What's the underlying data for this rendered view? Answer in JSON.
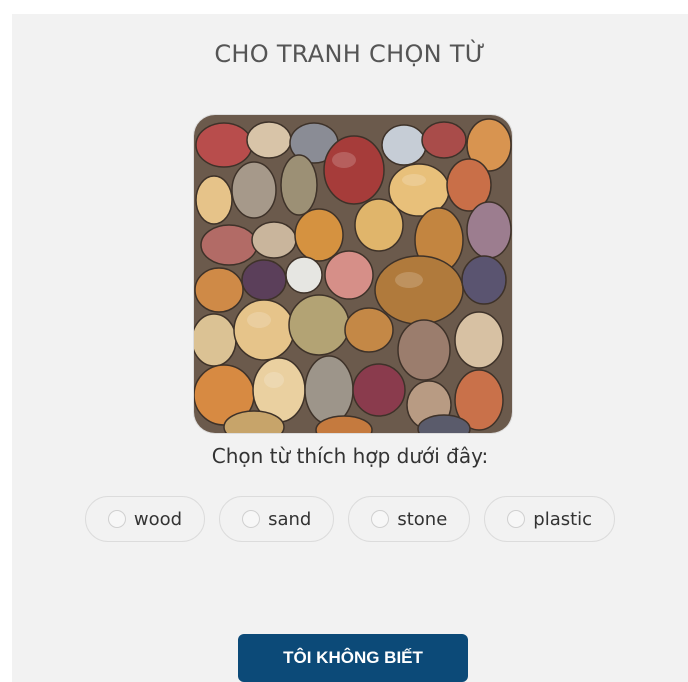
{
  "quiz": {
    "title": "CHO TRANH CHỌN TỪ",
    "prompt": "Chọn từ thích hợp dưới đây:",
    "options": [
      {
        "label": "wood"
      },
      {
        "label": "sand"
      },
      {
        "label": "stone"
      },
      {
        "label": "plastic"
      }
    ],
    "dont_know_label": "TÔI KHÔNG BIẾT"
  },
  "image": {
    "subject": "pebble-stones-photo"
  },
  "colors": {
    "button_bg": "#0c4a78",
    "panel_bg": "#f2f2f2",
    "text": "#333333"
  }
}
